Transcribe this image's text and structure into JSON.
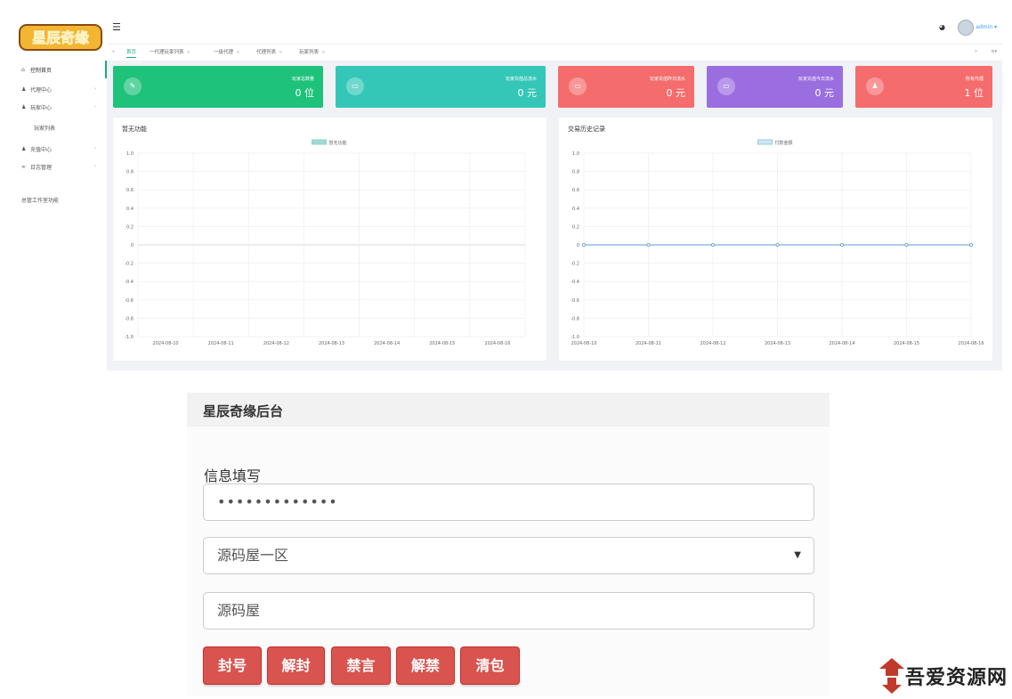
{
  "sidebar": {
    "logo_text": "星辰奇缘",
    "items": [
      {
        "label": "控制首页",
        "icon": "home-icon",
        "has_arrow": false
      },
      {
        "label": "代理中心",
        "icon": "user-icon",
        "has_arrow": true
      },
      {
        "label": "玩家中心",
        "icon": "user-icon",
        "has_arrow": true
      },
      {
        "label": "玩家列表",
        "icon": "",
        "has_arrow": false
      },
      {
        "label": "充值中心",
        "icon": "user-icon",
        "has_arrow": true
      },
      {
        "label": "日志管理",
        "icon": "link-icon",
        "has_arrow": true
      },
      {
        "label": "总管工作室功能",
        "icon": "",
        "has_arrow": false
      }
    ]
  },
  "topbar": {
    "user_name": "admin ▾"
  },
  "tabs": [
    "首页",
    "一代理玩家列表",
    "一级代理",
    "代理列表",
    "玩家列表"
  ],
  "stats": [
    {
      "label": "玩家总数量",
      "value": "0 位",
      "color": "#1ec27b",
      "icon": "leaf-icon"
    },
    {
      "label": "玩家充值总流水",
      "value": "0 元",
      "color": "#34c7b8",
      "icon": "monitor-icon"
    },
    {
      "label": "玩家充值昨日流水",
      "value": "0 元",
      "color": "#f56c6c",
      "icon": "monitor-icon"
    },
    {
      "label": "玩家充值今日流水",
      "value": "0 元",
      "color": "#9b6ee0",
      "icon": "monitor-icon"
    },
    {
      "label": "所有代理",
      "value": "1 位",
      "color": "#f56c6c",
      "icon": "person-icon"
    }
  ],
  "panels": {
    "left_title": "暂无功能",
    "right_title": "交易历史记录"
  },
  "chart_data": [
    {
      "type": "bar",
      "legend": [
        "暂无功能"
      ],
      "categories": [
        "2024-08-10",
        "2024-08-11",
        "2024-08-12",
        "2024-08-13",
        "2024-08-14",
        "2024-08-15",
        "2024-08-16"
      ],
      "series": [
        {
          "name": "暂无功能",
          "values": []
        }
      ],
      "ylim": [
        -1.0,
        1.0
      ],
      "yticks": [
        "1.0",
        "0.8",
        "0.6",
        "0.4",
        "0.2",
        "0",
        "-0.2",
        "-0.4",
        "-0.6",
        "-0.8",
        "-1.0"
      ],
      "legend_color": "#9bdccf",
      "grid": true,
      "legend_position": "top"
    },
    {
      "type": "line",
      "legend": [
        "付款金额"
      ],
      "categories": [
        "2024-08-10",
        "2024-08-11",
        "2024-08-12",
        "2024-08-13",
        "2024-08-14",
        "2024-08-15",
        "2024-08-16"
      ],
      "series": [
        {
          "name": "付款金额",
          "values": [
            0,
            0,
            0,
            0,
            0,
            0,
            0
          ]
        }
      ],
      "ylim": [
        -1.0,
        1.0
      ],
      "yticks": [
        "1.0",
        "0.8",
        "0.6",
        "0.4",
        "0.2",
        "0",
        "-0.2",
        "-0.4",
        "-0.6",
        "-0.8",
        "-1.0"
      ],
      "legend_color": "#cfe3f7",
      "line_color": "#5b9bd5",
      "grid": true,
      "legend_position": "top"
    }
  ],
  "form": {
    "title": "星辰奇缘后台",
    "section_label": "信息填写",
    "password_value": "•••••••••••••",
    "server_selected": "源码屋一区",
    "name_value": "源码屋",
    "buttons": [
      "封号",
      "解封",
      "禁言",
      "解禁",
      "清包"
    ]
  },
  "watermark": {
    "text": "吾爱资源网"
  }
}
